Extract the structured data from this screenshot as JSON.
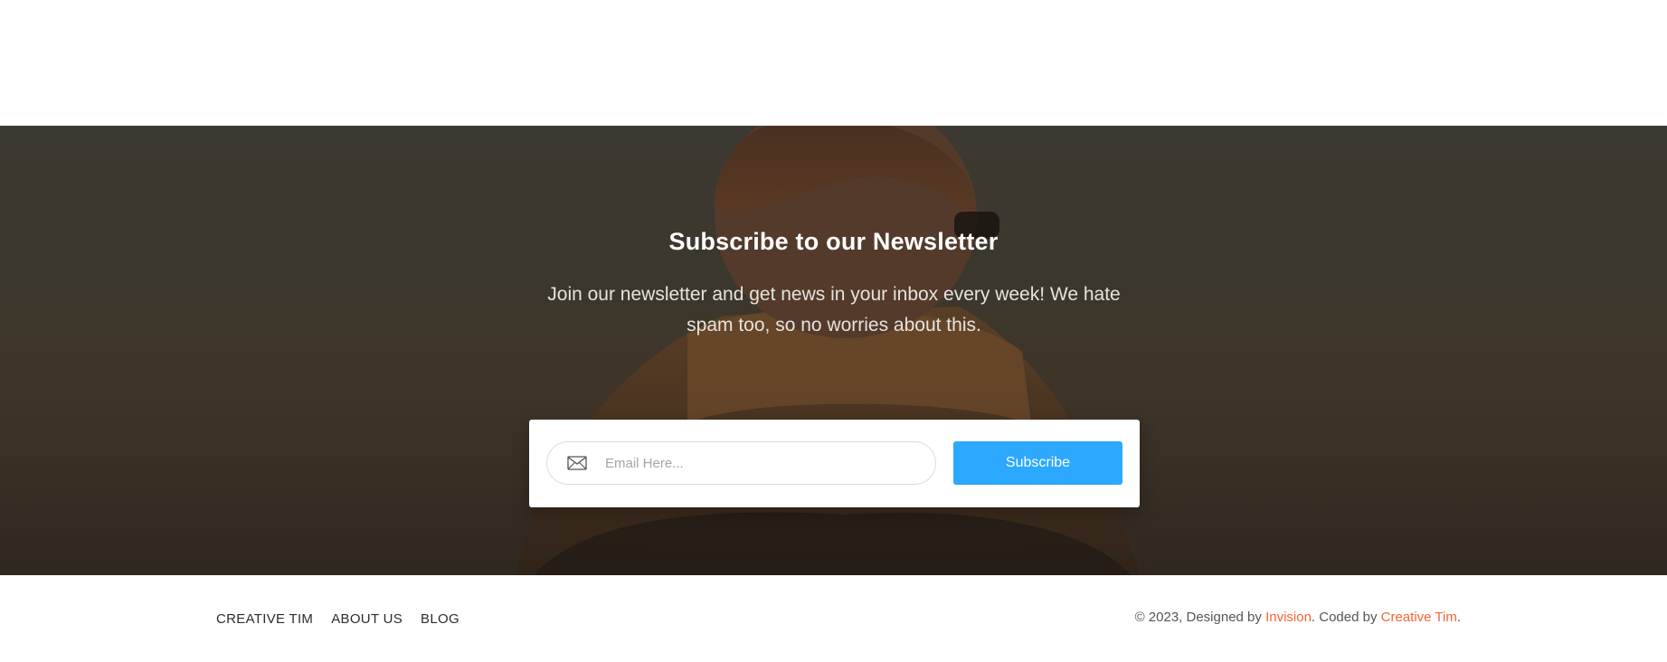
{
  "hero": {
    "title": "Subscribe to our Newsletter",
    "description": "Join our newsletter and get news in your inbox every week! We hate spam too, so no worries about this."
  },
  "form": {
    "email_placeholder": "Email Here...",
    "email_value": "",
    "subscribe_label": "Subscribe"
  },
  "footer": {
    "nav": [
      "CREATIVE TIM",
      "ABOUT US",
      "BLOG"
    ],
    "copyright": {
      "prefix": "© 2023, Designed by ",
      "designer": "Invision",
      "middle": ". Coded by ",
      "coder": "Creative Tim",
      "suffix": "."
    }
  },
  "colors": {
    "primary_button": "#2ca8ff",
    "link_accent": "#f96332",
    "hero_text": "#ffffff"
  },
  "icons": {
    "email": "envelope-icon"
  }
}
